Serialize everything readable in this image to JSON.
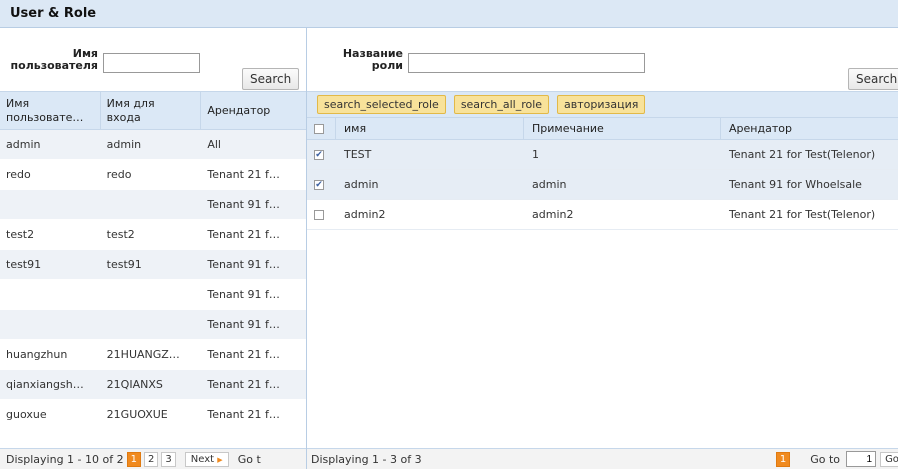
{
  "window": {
    "title": "User & Role"
  },
  "user_panel": {
    "filter_label": "Имя\nпользователя",
    "filter_value": "",
    "search_label": "Search",
    "columns": [
      "Имя\nпользовате…",
      "Имя для\nвхода",
      "Арендатор"
    ],
    "rows": [
      [
        "admin",
        "admin",
        "All"
      ],
      [
        "redo",
        "redo",
        "Tenant 21 f…"
      ],
      [
        "",
        "",
        "Tenant 91 f…"
      ],
      [
        "test2",
        "test2",
        "Tenant 21 f…"
      ],
      [
        "test91",
        "test91",
        "Tenant 91 f…"
      ],
      [
        "",
        "",
        "Tenant 91 f…"
      ],
      [
        "",
        "",
        "Tenant 91 f…"
      ],
      [
        "huangzhun",
        "21HUANGZ…",
        "Tenant 21 f…"
      ],
      [
        "qianxiangsh…",
        "21QIANXS",
        "Tenant 21 f…"
      ],
      [
        "guoxue",
        "21GUOXUE",
        "Tenant 21 f…"
      ]
    ],
    "pager": {
      "display_text": "Displaying 1 - 10 of 2",
      "pages": [
        "1",
        "2",
        "3"
      ],
      "active_page": "1",
      "next_label": "Next",
      "goto_label": "Go t"
    }
  },
  "role_panel": {
    "filter_label": "Название\nроли",
    "filter_value": "",
    "search_label": "Search",
    "toolbar": [
      "search_selected_role",
      "search_all_role",
      "авторизация"
    ],
    "columns": [
      "имя",
      "Примечание",
      "Арендатор"
    ],
    "rows": [
      {
        "checked": true,
        "cells": [
          "TEST",
          "1",
          "Tenant 21 for Test(Telenor)"
        ]
      },
      {
        "checked": true,
        "cells": [
          "admin",
          "admin",
          "Tenant 91 for Whoelsale"
        ]
      },
      {
        "checked": false,
        "cells": [
          "admin2",
          "admin2",
          "Tenant 21 for Test(Telenor)"
        ]
      }
    ],
    "pager": {
      "display_text": "Displaying 1 - 3 of 3",
      "active_page": "1",
      "goto_label": "Go to",
      "goto_value": "1",
      "go_button": "Go"
    }
  }
}
